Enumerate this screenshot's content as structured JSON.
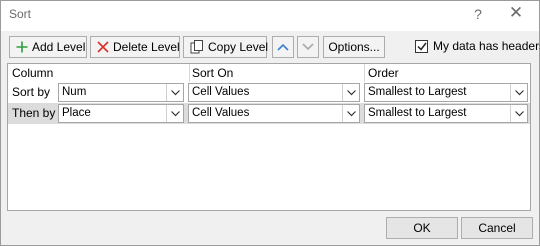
{
  "window": {
    "title": "Sort",
    "help_glyph": "?",
    "close_glyph": "✕"
  },
  "toolbar": {
    "add_level": "Add Level",
    "delete_level": "Delete Level",
    "copy_level": "Copy Level",
    "options": "Options...",
    "headers_checkbox_label": "My data has headers",
    "headers_checked": true
  },
  "grid": {
    "columns": {
      "column": "Column",
      "sort_on": "Sort On",
      "order": "Order"
    },
    "rows": [
      {
        "label": "Sort by",
        "column": "Num",
        "sort_on": "Cell Values",
        "order": "Smallest to Largest",
        "selected": false
      },
      {
        "label": "Then by",
        "column": "Place",
        "sort_on": "Cell Values",
        "order": "Smallest to Largest",
        "selected": true
      }
    ]
  },
  "footer": {
    "ok": "OK",
    "cancel": "Cancel"
  },
  "colors": {
    "add_icon": "#2e9e3e",
    "delete_icon": "#d9302c",
    "move_up_arrow": "#3b7fd0",
    "move_down_arrow": "#a9a9a9"
  }
}
